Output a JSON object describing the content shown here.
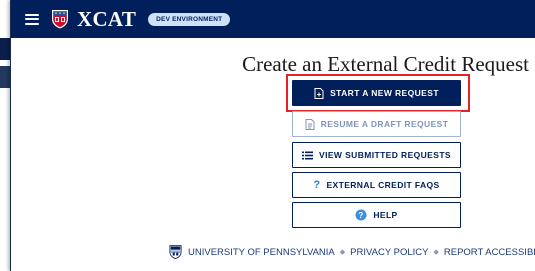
{
  "header": {
    "app_name": "XCAT",
    "env_badge": "DEV ENVIRONMENT"
  },
  "main": {
    "title": "Create an External Credit Request",
    "buttons": {
      "start": "START A NEW REQUEST",
      "resume": "RESUME A DRAFT REQUEST",
      "view": "VIEW SUBMITTED REQUESTS",
      "faqs": "EXTERNAL CREDIT FAQS",
      "help": "HELP"
    }
  },
  "footer": {
    "university": "UNIVERSITY OF PENNSYLVANIA",
    "privacy": "PRIVACY POLICY",
    "accessibility": "REPORT ACCESSIBILITY IS",
    "separator": "◆"
  },
  "colors": {
    "brand_navy": "#011f5b",
    "highlight_red": "#e0242a",
    "link_blue": "#1e3b7a"
  },
  "icons": {
    "menu": "hamburger-menu-icon",
    "logo": "penn-shield-icon",
    "start": "file-plus-icon",
    "resume": "file-text-icon",
    "view": "list-icon",
    "faqs": "question-mark-icon",
    "help": "help-circle-icon"
  }
}
